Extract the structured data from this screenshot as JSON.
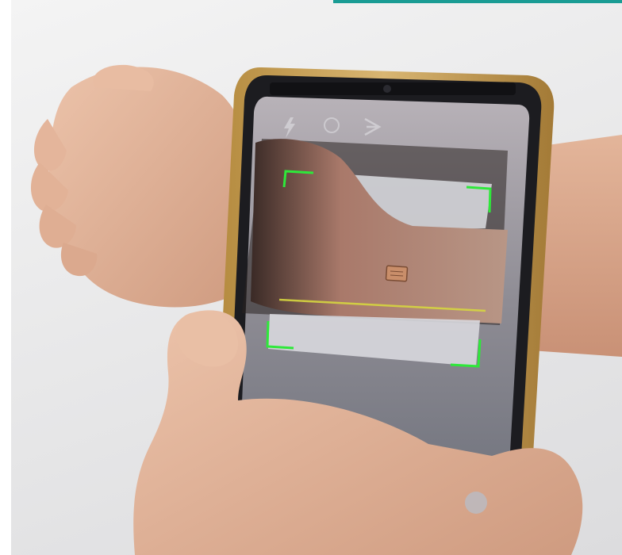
{
  "image": {
    "description_colors": {
      "background": "#e6e6e8",
      "accent_bar": "#1a9c94",
      "skin": "#dcaa8f",
      "phone_frame": "#c9a25a",
      "scan_corner": "#2ee83a",
      "scan_line": "#d6d640",
      "chip": "#c98e6a"
    }
  },
  "phone": {
    "status_bar_text": "",
    "toolbar_icons": [
      "flash-icon",
      "timer-icon",
      "share-icon"
    ]
  },
  "scanner": {
    "overlay": "bounding-box",
    "target": "implanted-chip"
  }
}
